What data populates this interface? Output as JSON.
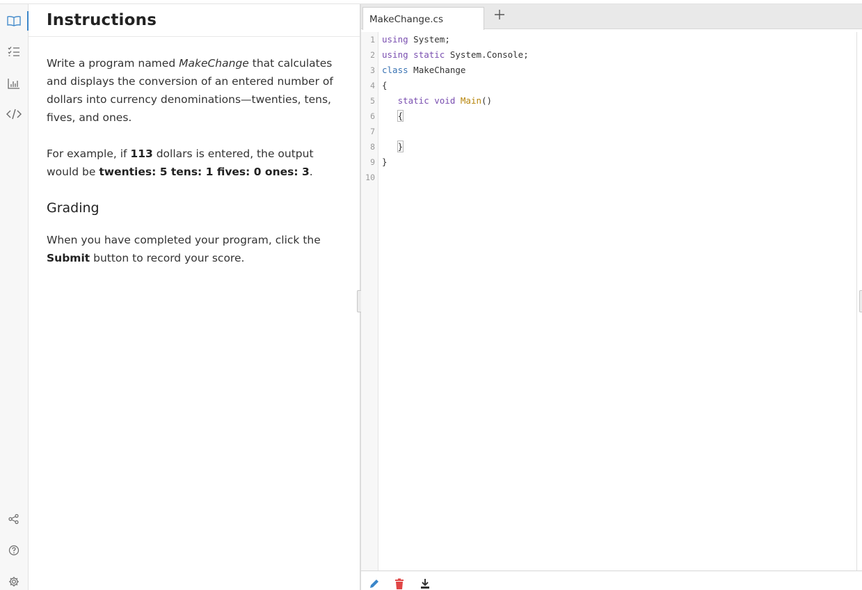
{
  "rail": {
    "icons": [
      "book-icon",
      "checklist-icon",
      "chart-icon",
      "code-icon",
      "share-icon",
      "help-icon",
      "settings-icon"
    ],
    "active_color": "#3b86c9"
  },
  "instructions": {
    "title": "Instructions",
    "p1_a": "Write a program named ",
    "p1_em": "MakeChange",
    "p1_b": " that calculates and displays the conversion of an entered number of dollars into currency denominations—twenties, tens, fives, and ones.",
    "p2_a": "For example, if ",
    "p2_num": "113",
    "p2_b": " dollars is entered, the output would be ",
    "p2_out": "twenties: 5 tens: 1 fives: 0 ones: 3",
    "p2_c": ".",
    "grading_heading": "Grading",
    "p3_a": "When you have completed your program, click the ",
    "p3_btn": "Submit",
    "p3_b": " button to record your score."
  },
  "editor": {
    "tab_label": "MakeChange.cs",
    "add_tab_symbol": "+",
    "line_numbers": [
      "1",
      "2",
      "3",
      "4",
      "5",
      "6",
      "7",
      "8",
      "9",
      "10"
    ],
    "code": {
      "l1_kw": "using",
      "l1_rest": " System;",
      "l2_kw": "using",
      "l2_kw2": " static",
      "l2_rest": " System.Console;",
      "l3_kw": "class",
      "l3_rest": " MakeChange",
      "l4": "{",
      "l5_ind": "   ",
      "l5_kw": "static",
      "l5_kw2": " void",
      "l5_fn": " Main",
      "l5_rest": "()",
      "l6_ind": "   ",
      "l6": "{",
      "l8_ind": "   ",
      "l8": "}",
      "l9": "}"
    }
  },
  "bottombar": {
    "icons": [
      "pencil-icon",
      "trash-icon",
      "download-icon"
    ],
    "colors": {
      "pencil": "#3b86c9",
      "trash": "#e04545",
      "download": "#333333"
    }
  }
}
